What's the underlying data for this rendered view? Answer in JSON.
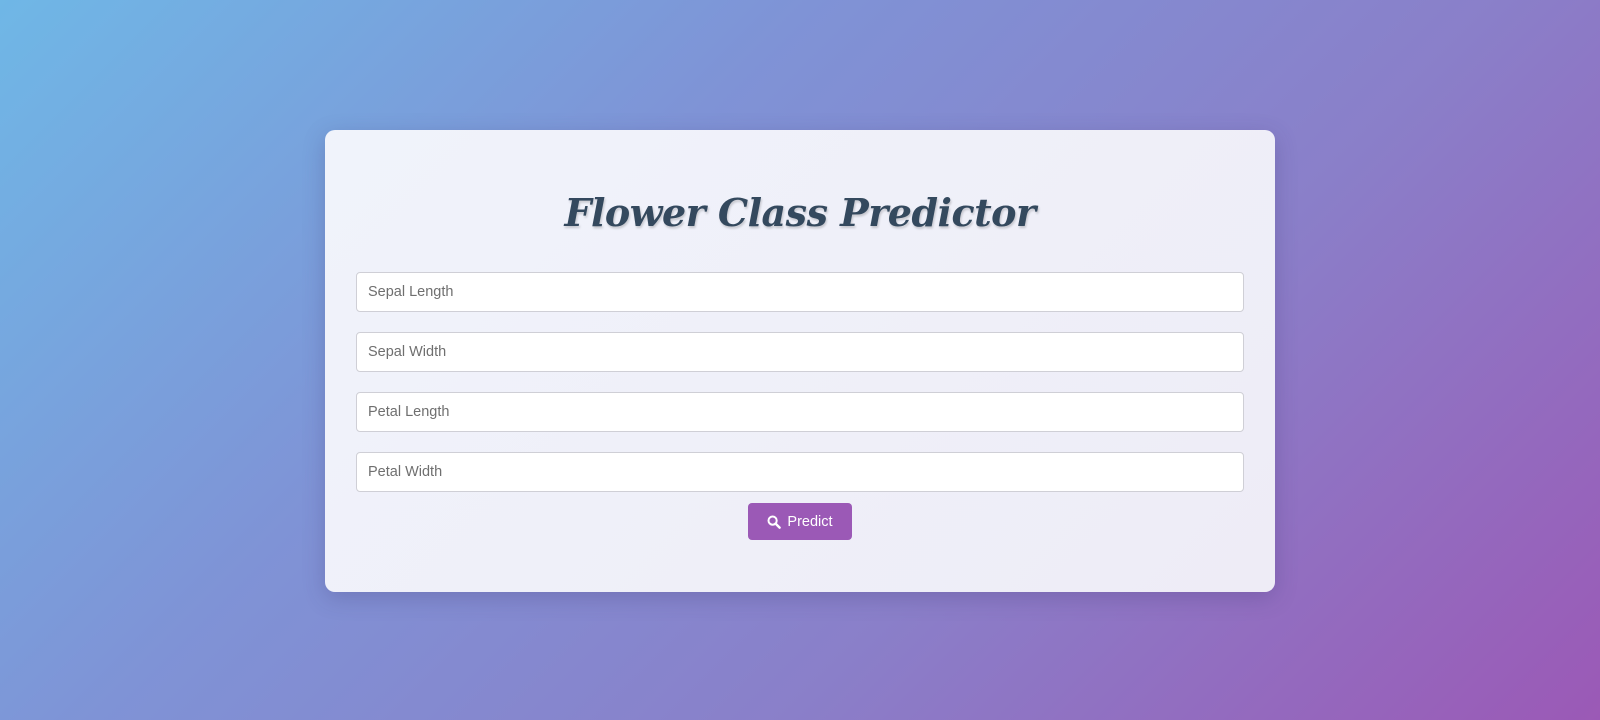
{
  "form": {
    "title": "Flower Class Predictor",
    "fields": [
      {
        "name": "sepal-length",
        "placeholder": "Sepal Length",
        "value": ""
      },
      {
        "name": "sepal-width",
        "placeholder": "Sepal Width",
        "value": ""
      },
      {
        "name": "petal-length",
        "placeholder": "Petal Length",
        "value": ""
      },
      {
        "name": "petal-width",
        "placeholder": "Petal Width",
        "value": ""
      }
    ],
    "submit": {
      "label": "Predict",
      "icon": "search-icon"
    }
  },
  "colors": {
    "accent": "#9b59b6",
    "title": "#34495e",
    "background_start": "#6fb7e6",
    "background_end": "#9b59b6"
  }
}
